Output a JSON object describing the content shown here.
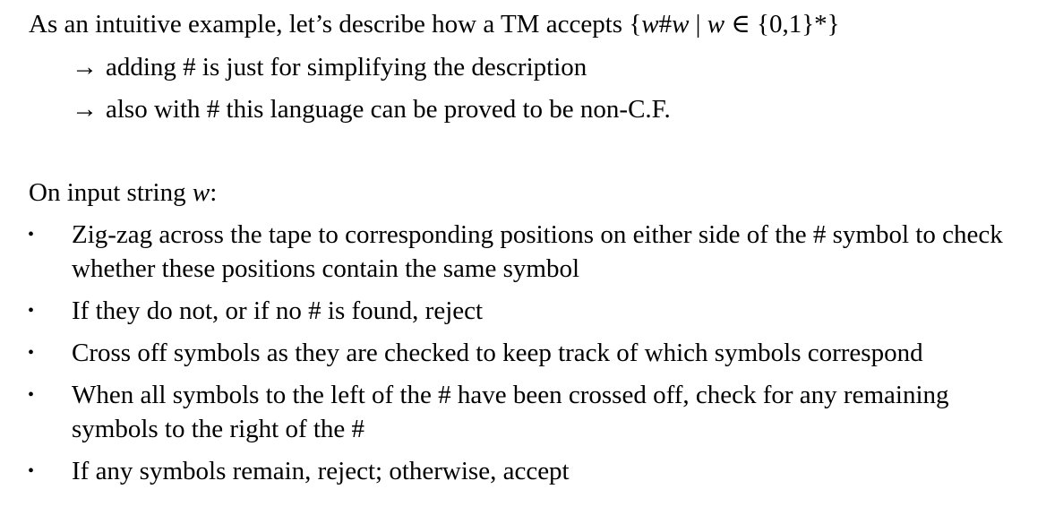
{
  "intro": {
    "text_before": "As an intuitive example, let’s describe how a TM accepts ",
    "set_notation": "{w#w | w ∈ {0,1}*}"
  },
  "notes": [
    {
      "arrow": "→",
      "text": "adding # is just for simplifying the description"
    },
    {
      "arrow": "→",
      "text": "also with # this language can be proved to be non-C.F."
    }
  ],
  "input_label": {
    "prefix": "On input string ",
    "var": "w",
    "suffix": ":"
  },
  "steps": [
    {
      "bullet": "•",
      "text": "Zig-zag across the tape to corresponding positions on either side of the # symbol to check whether these positions contain the same symbol"
    },
    {
      "bullet": "•",
      "text": "If they do not, or if no # is found, reject"
    },
    {
      "bullet": "•",
      "text": "Cross off symbols as they are checked to keep track of which symbols correspond"
    },
    {
      "bullet": "•",
      "text": "When all symbols to the left of the # have been crossed off, check for any remaining symbols to the right of the #"
    },
    {
      "bullet": "•",
      "text": "If any symbols remain, reject; otherwise, accept"
    }
  ]
}
